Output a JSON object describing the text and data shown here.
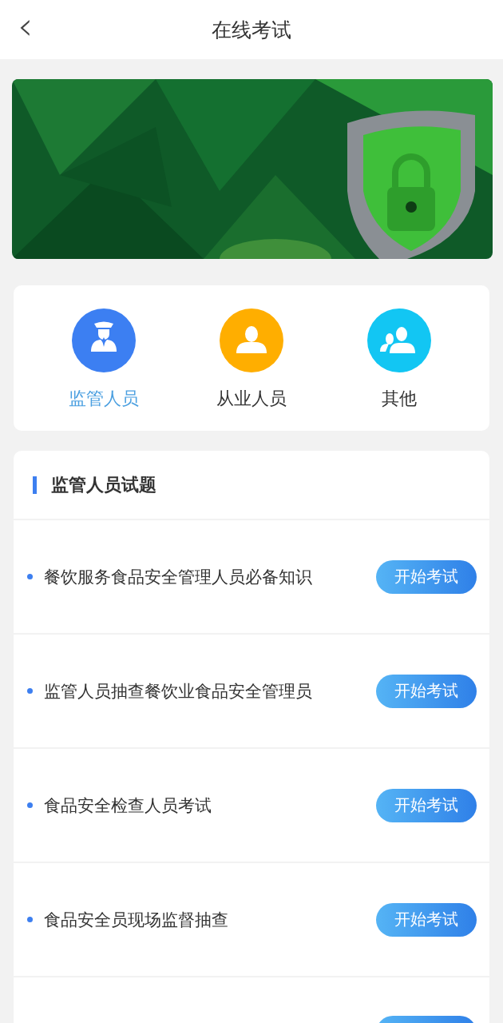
{
  "header": {
    "back_icon": "‹",
    "title": "在线考试"
  },
  "categories": [
    {
      "label": "监管人员",
      "selected": true,
      "kind": "officer",
      "color": "#3c7ff2"
    },
    {
      "label": "从业人员",
      "selected": false,
      "kind": "person",
      "color": "#ffae00"
    },
    {
      "label": "其他",
      "selected": false,
      "kind": "group",
      "color": "#12c6f3"
    }
  ],
  "section": {
    "title": "监管人员试题"
  },
  "exams": [
    {
      "kind": "full",
      "title": "餐饮服务食品安全管理人员必备知识",
      "button": "开始考试"
    },
    {
      "kind": "full",
      "title": "监管人员抽查餐饮业食品安全管理员",
      "button": "开始考试"
    },
    {
      "kind": "full",
      "title": "食品安全检查人员考试",
      "button": "开始考试"
    },
    {
      "kind": "full",
      "title": "食品安全员现场监督抽查",
      "button": "开始考试"
    },
    {
      "kind": "partial"
    }
  ]
}
